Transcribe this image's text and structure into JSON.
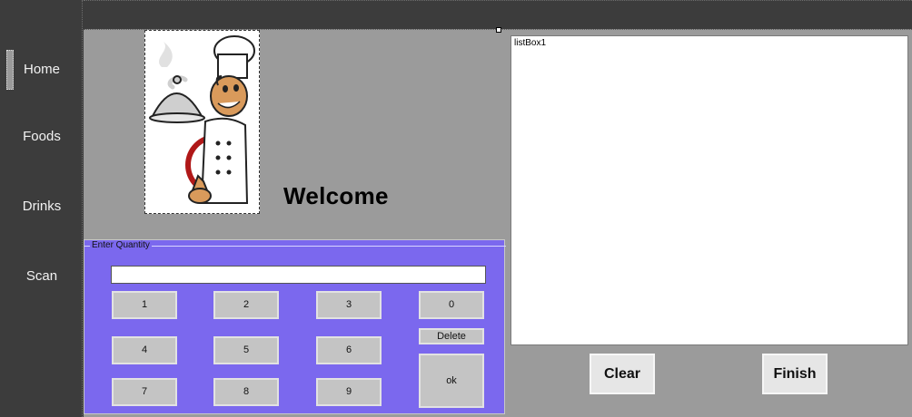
{
  "sidebar": {
    "items": [
      {
        "label": "Home"
      },
      {
        "label": "Foods"
      },
      {
        "label": "Drinks"
      },
      {
        "label": "Scan"
      }
    ]
  },
  "main": {
    "welcome": "Welcome",
    "chef_image": "chef-waiter-image"
  },
  "quantity_group": {
    "legend": "Enter Quantity",
    "input_value": "",
    "keys": {
      "k1": "1",
      "k2": "2",
      "k3": "3",
      "k0": "0",
      "k4": "4",
      "k5": "5",
      "k6": "6",
      "delete": "Delete",
      "k7": "7",
      "k8": "8",
      "k9": "9",
      "ok": "ok"
    }
  },
  "listbox": {
    "text": "listBox1"
  },
  "buttons": {
    "clear": "Clear",
    "finish": "Finish"
  },
  "colors": {
    "sidebar_bg": "#3c3c3c",
    "panel_bg": "#9b9b9b",
    "group_bg": "#7b68ee",
    "key_bg": "#c4c4c4"
  }
}
